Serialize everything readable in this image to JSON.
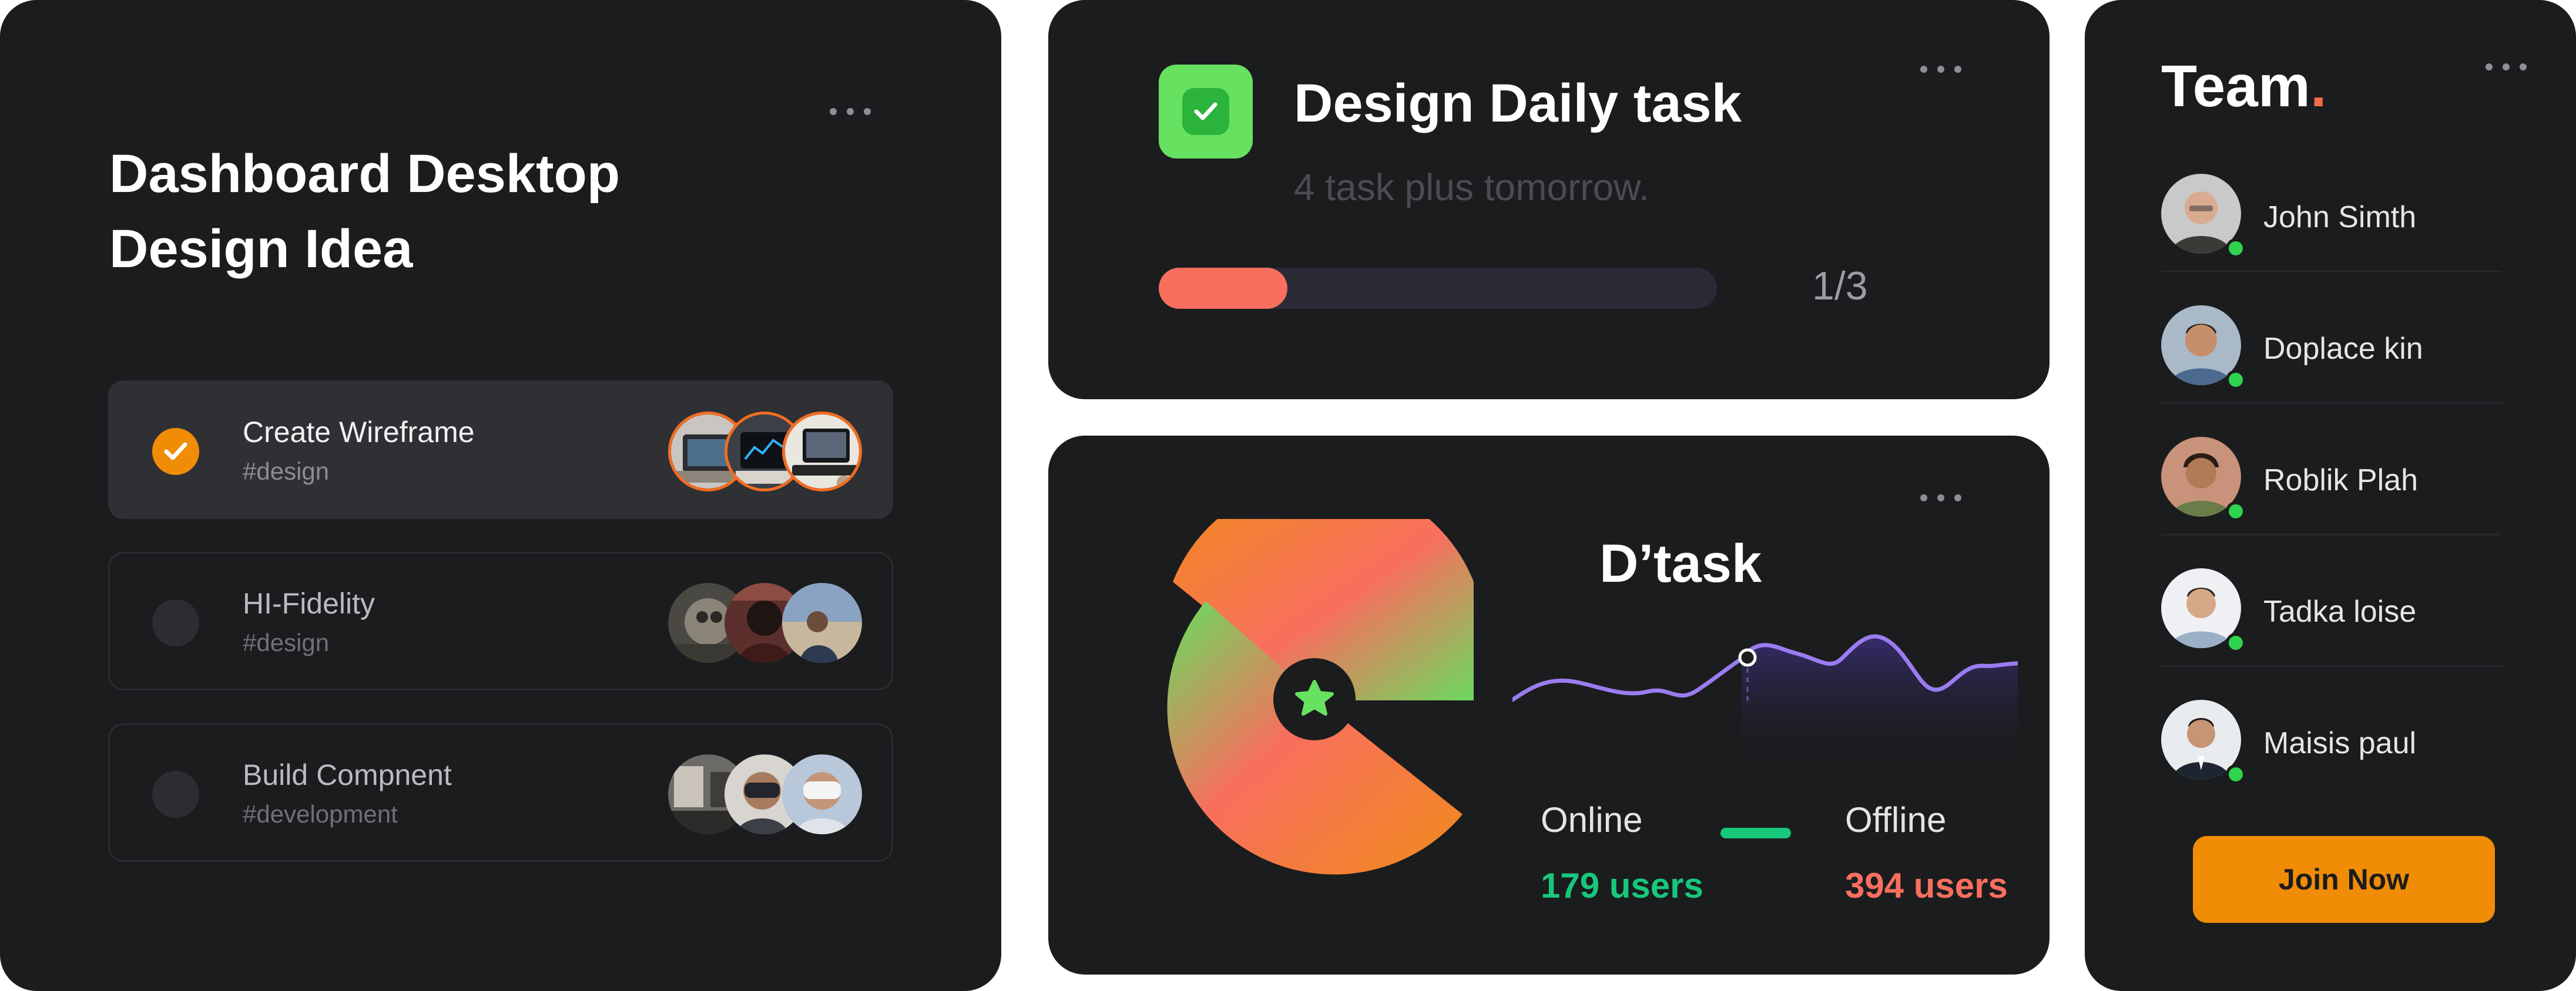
{
  "tasks_card": {
    "title_line1": "Dashboard Desktop",
    "title_line2": "Design Idea",
    "menu_icon": "more-horizontal-icon",
    "tasks": [
      {
        "name": "Create Wireframe",
        "tag": "#design",
        "done": true
      },
      {
        "name": "HI-Fidelity",
        "tag": "#design",
        "done": false
      },
      {
        "name": "Build Compnent",
        "tag": "#development",
        "done": false
      }
    ]
  },
  "daily_card": {
    "icon": "checkbox-icon",
    "title": "Design Daily task",
    "subtitle": "4 task plus tomorrow.",
    "progress": 0.23,
    "progress_label": "1/3",
    "menu_icon": "more-horizontal-icon"
  },
  "dtask_card": {
    "title": "D’task",
    "online_label": "Online",
    "online_value": "179 users",
    "offline_label": "Offline",
    "offline_value": "394 users",
    "colors": {
      "online": "#18c77b",
      "offline": "#f86f5e",
      "accent_green": "#67e160",
      "accent_orange": "#f08c06"
    },
    "menu_icon": "more-horizontal-icon"
  },
  "team_card": {
    "title": "Team",
    "title_dot": ".",
    "members": [
      {
        "name": "John Simth",
        "status": "online"
      },
      {
        "name": "Doplace kin",
        "status": "online"
      },
      {
        "name": "Roblik Plah",
        "status": "online"
      },
      {
        "name": "Tadka loise",
        "status": "online"
      },
      {
        "name": "Maisis paul",
        "status": "online"
      }
    ],
    "join_label": "Join Now",
    "menu_icon": "more-horizontal-icon"
  }
}
